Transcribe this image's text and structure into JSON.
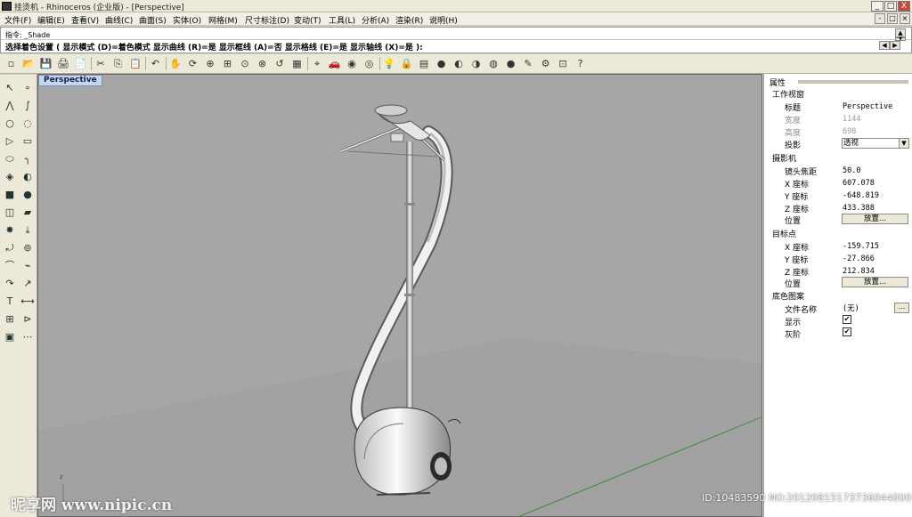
{
  "window": {
    "title": "挂烫机 - Rhinoceros (企业版) - [Perspective]",
    "buttons": {
      "minimize": "_",
      "maximize": "□",
      "close": "X"
    }
  },
  "menu": {
    "items": [
      "文件(F)",
      "编辑(E)",
      "查看(V)",
      "曲线(C)",
      "曲面(S)",
      "实体(O)",
      "网格(M)",
      "尺寸标注(D)",
      "变动(T)",
      "工具(L)",
      "分析(A)",
      "渲染(R)",
      "说明(H)"
    ],
    "mdi_buttons": [
      "-",
      "□",
      "×"
    ]
  },
  "command": {
    "history": "指令: _Shade",
    "prompt": "选择着色设置 ( 显示模式 (D)=着色模式  显示曲线 (R)=是  显示框线 (A)=否  显示格线 (E)=是  显示轴线 (X)=是 ):",
    "scroll_buttons": [
      "▲",
      "▼",
      "◀",
      "▶"
    ]
  },
  "toolbar": {
    "icons": [
      "new-file-icon",
      "open-file-icon",
      "save-icon",
      "print-icon",
      "import-icon",
      "cut-icon",
      "copy-icon",
      "paste-icon",
      "undo-icon",
      "pan-hand-icon",
      "rotate-view-icon",
      "zoom-window-icon",
      "zoom-extents-icon",
      "zoom-selected-icon",
      "zoom-dynamic-icon",
      "undo-view-icon",
      "four-viewports-icon",
      "set-cplane-icon",
      "car-icon",
      "hide-icon",
      "show-icon",
      "lightbulb-icon",
      "lock-icon",
      "layer-icon",
      "color-wheel-icon",
      "rendered-sphere-icon",
      "shaded-sphere-icon",
      "render-icon",
      "blue-sphere-icon",
      "paint-icon",
      "options-icon",
      "grid-snap-icon",
      "help-icon"
    ],
    "glyphs": [
      "▫",
      "📂",
      "💾",
      "🖨",
      "📄",
      "✂",
      "⎘",
      "📋",
      "↶",
      "✋",
      "⟳",
      "⊕",
      "⊞",
      "⊙",
      "⊗",
      "↺",
      "▦",
      "⌖",
      "🚗",
      "◉",
      "◎",
      "💡",
      "🔒",
      "▤",
      "●",
      "◐",
      "◑",
      "◍",
      "●",
      "✎",
      "⚙",
      "⊡",
      "?"
    ]
  },
  "lefttools": {
    "icons": [
      "select-arrow-icon",
      "point-icon",
      "polyline-icon",
      "curve-icon",
      "circle-icon",
      "arc-icon",
      "polygon-icon",
      "rectangle-icon",
      "ellipse-icon",
      "fillet-icon",
      "surface-icon",
      "revolve-icon",
      "box-icon",
      "sphere-icon",
      "cylinder-icon",
      "extrude-icon",
      "explode-icon",
      "split-icon",
      "trim-icon",
      "boolean-icon",
      "loft-icon",
      "sweep-icon",
      "offset-icon",
      "transform-icon",
      "text-icon",
      "dimension-icon",
      "array-icon",
      "mirror-icon",
      "solid-box-icon",
      "grid-icon"
    ],
    "glyphs": [
      "↖",
      "∘",
      "⋀",
      "∫",
      "○",
      "◌",
      "▷",
      "▭",
      "⬭",
      "╮",
      "◈",
      "◐",
      "■",
      "●",
      "◫",
      "▰",
      "✸",
      "⤓",
      "⤾",
      "⊚",
      "⌒",
      "⌁",
      "↷",
      "↗",
      "T",
      "⟷",
      "⊞",
      "⊳",
      "▣",
      "⋯"
    ]
  },
  "viewport": {
    "label": "Perspective"
  },
  "properties": {
    "header": "属性",
    "viewport_section": "工作视窗",
    "title_label": "标题",
    "title_value": "Perspective",
    "width_label": "宽度",
    "width_value": "1144",
    "height_label": "高度",
    "height_value": "698",
    "projection_label": "投影",
    "projection_value": "透视",
    "camera_section": "摄影机",
    "lens_label": "镜头焦距",
    "lens_value": "50.0",
    "cam_x_label": "X 座标",
    "cam_x_value": "607.078",
    "cam_y_label": "Y 座标",
    "cam_y_value": "-648.819",
    "cam_z_label": "Z 座标",
    "cam_z_value": "433.388",
    "cam_loc_label": "位置",
    "cam_loc_button": "放置...",
    "target_section": "目标点",
    "tgt_x_label": "X 座标",
    "tgt_x_value": "-159.715",
    "tgt_y_label": "Y 座标",
    "tgt_y_value": "-27.866",
    "tgt_z_label": "Z 座标",
    "tgt_z_value": "212.834",
    "tgt_loc_label": "位置",
    "tgt_loc_button": "放置...",
    "bg_section": "底色图案",
    "file_label": "文件名称",
    "file_value": "(无)",
    "file_button": "...",
    "show_label": "显示",
    "show_checked": "✔",
    "gray_label": "灰阶",
    "gray_checked": "✔"
  },
  "watermark": {
    "left": "昵享网 www.nipic.cn",
    "right": "ID:10483590 NO:20120815173736044000"
  }
}
